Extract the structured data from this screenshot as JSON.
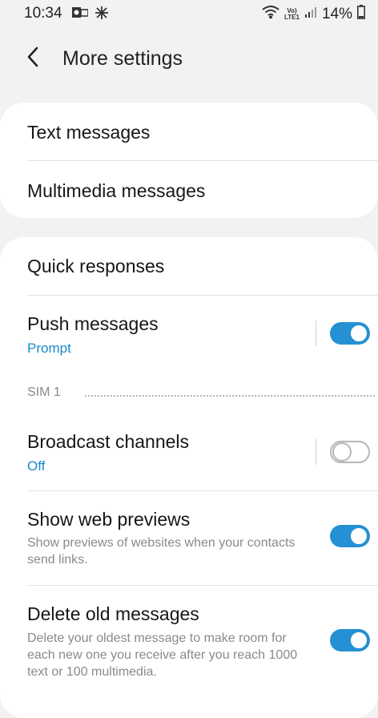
{
  "status_bar": {
    "time": "10:34",
    "volte_top": "Vo)",
    "volte_bottom": "LTE1",
    "battery": "14%"
  },
  "header": {
    "title": "More settings"
  },
  "card1": {
    "text_messages": "Text messages",
    "multimedia_messages": "Multimedia messages"
  },
  "card2": {
    "quick_responses": "Quick responses",
    "push_messages": {
      "title": "Push messages",
      "sub": "Prompt",
      "enabled": true
    },
    "section": "SIM 1",
    "broadcast": {
      "title": "Broadcast channels",
      "sub": "Off",
      "enabled": false
    },
    "web_previews": {
      "title": "Show web previews",
      "desc": "Show previews of websites when your contacts send links.",
      "enabled": true
    },
    "delete_old": {
      "title": "Delete old messages",
      "desc": "Delete your oldest message to make room for each new one you receive after you reach 1000 text or 100 multimedia.",
      "enabled": true
    }
  },
  "colors": {
    "accent": "#2590d3",
    "sub_text": "#1a8ac9",
    "background": "#f2f2f2"
  }
}
